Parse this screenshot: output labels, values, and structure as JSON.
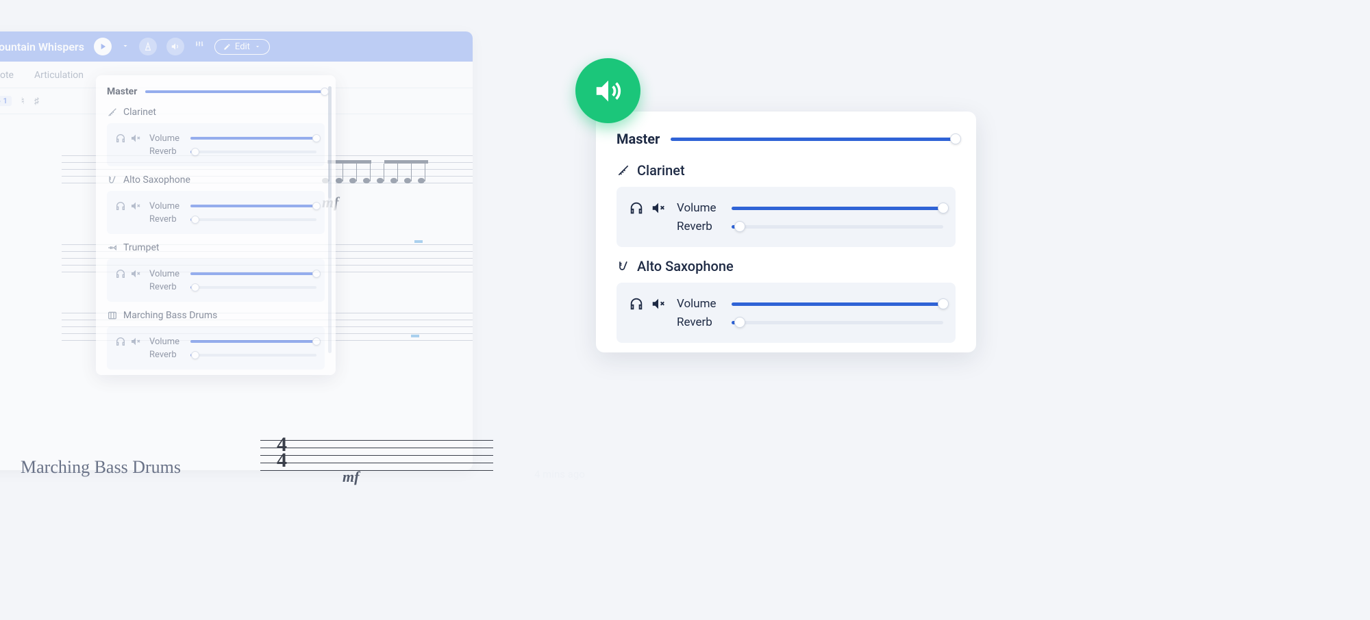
{
  "app": {
    "title": "Mountain Whispers",
    "edit_label": "Edit",
    "tabs": [
      "Note",
      "Articulation"
    ],
    "tool_badge": "1"
  },
  "mixer": {
    "master_label": "Master",
    "master_value": 100,
    "volume_label": "Volume",
    "reverb_label": "Reverb",
    "instruments": [
      {
        "name": "Clarinet",
        "volume": 100,
        "reverb": 4
      },
      {
        "name": "Alto Saxophone",
        "volume": 100,
        "reverb": 4
      },
      {
        "name": "Trumpet",
        "volume": 100,
        "reverb": 4
      },
      {
        "name": "Marching Bass Drums",
        "volume": 100,
        "reverb": 4
      }
    ]
  },
  "callout": {
    "master_label": "Master",
    "master_value": 100,
    "instruments": [
      {
        "name": "Clarinet",
        "volume": 100,
        "reverb": 4
      },
      {
        "name": "Alto Saxophone",
        "volume": 100,
        "reverb": 4
      }
    ],
    "volume_label": "Volume",
    "reverb_label": "Reverb"
  },
  "score": {
    "staff_label": "Marching Bass Drums",
    "dynamic": "mf"
  },
  "timestamp": "4 mins ago"
}
